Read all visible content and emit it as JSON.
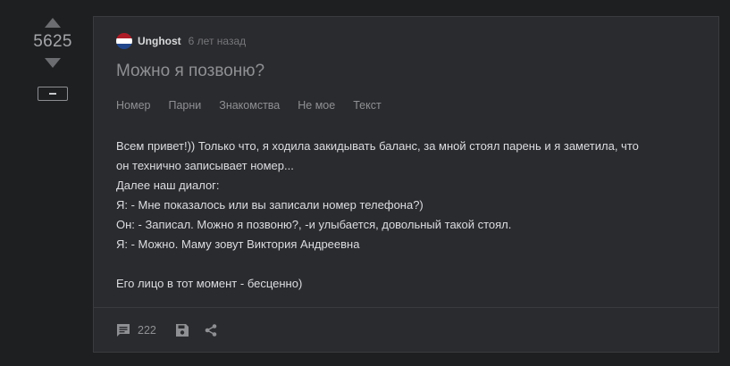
{
  "rating": {
    "score": "5625",
    "upvote_icon": "triangle-up-icon",
    "downvote_icon": "triangle-down-icon",
    "collapse_icon": "minus-icon"
  },
  "post": {
    "author": "Unghost",
    "time": "6 лет назад",
    "avatar_icon": "netherlands-flag-icon",
    "title": "Можно я позвоню?",
    "tags": [
      "Номер",
      "Парни",
      "Знакомства",
      "Не мое",
      "Текст"
    ],
    "body": [
      "Всем привет!)) Только что, я ходила закидывать баланс, за мной стоял парень и я заметила, что",
      "он технично записывает номер...",
      "Далее наш диалог:",
      "Я: - Мне показалось или вы записали номер телефона?)",
      "Он: - Записал. Можно я позвоню?, -и улыбается, довольный такой стоял.",
      "Я: - Можно. Маму зовут Виктория Андреевна",
      "",
      "Его лицо в тот момент - бесценно)"
    ],
    "footer": {
      "comments_count": "222",
      "comments_icon": "comment-icon",
      "save_icon": "save-icon",
      "share_icon": "share-icon"
    }
  },
  "colors": {
    "background": "#1e1f21",
    "card": "#2a2b2e",
    "border": "#3a3b3e",
    "muted_text": "#8f9093",
    "body_text": "#dcdde0",
    "flag_red": "#ae1c28",
    "flag_blue": "#21468b"
  }
}
